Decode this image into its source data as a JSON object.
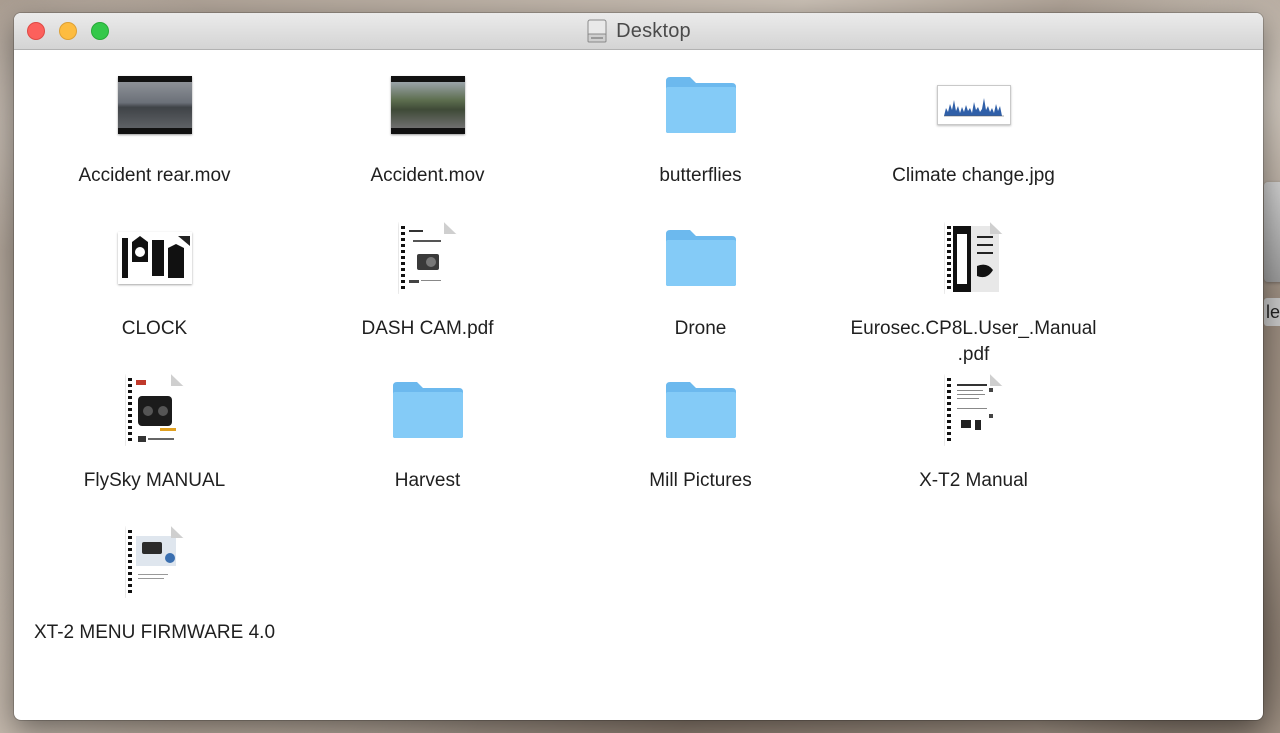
{
  "window": {
    "title": "Desktop"
  },
  "colors": {
    "folder": "#7cc6f5",
    "close": "#fc605c",
    "minimize": "#fdbc40",
    "zoom": "#34c84a"
  },
  "background_peek_label": "le",
  "items": [
    {
      "name": "Accident rear.mov",
      "kind": "video"
    },
    {
      "name": "Accident.mov",
      "kind": "video"
    },
    {
      "name": "butterflies",
      "kind": "folder"
    },
    {
      "name": "Climate change.jpg",
      "kind": "image"
    },
    {
      "name": "CLOCK",
      "kind": "image"
    },
    {
      "name": "DASH CAM.pdf",
      "kind": "pdf"
    },
    {
      "name": "Drone",
      "kind": "folder"
    },
    {
      "name": "Eurosec.CP8L.User_.Manual\n.pdf",
      "kind": "pdf"
    },
    {
      "name": "FlySky MANUAL",
      "kind": "pdf"
    },
    {
      "name": "Harvest",
      "kind": "folder"
    },
    {
      "name": "Mill Pictures",
      "kind": "folder"
    },
    {
      "name": "X-T2 Manual",
      "kind": "pdf"
    },
    {
      "name": "XT-2 MENU FIRMWARE 4.0",
      "kind": "pdf"
    }
  ]
}
